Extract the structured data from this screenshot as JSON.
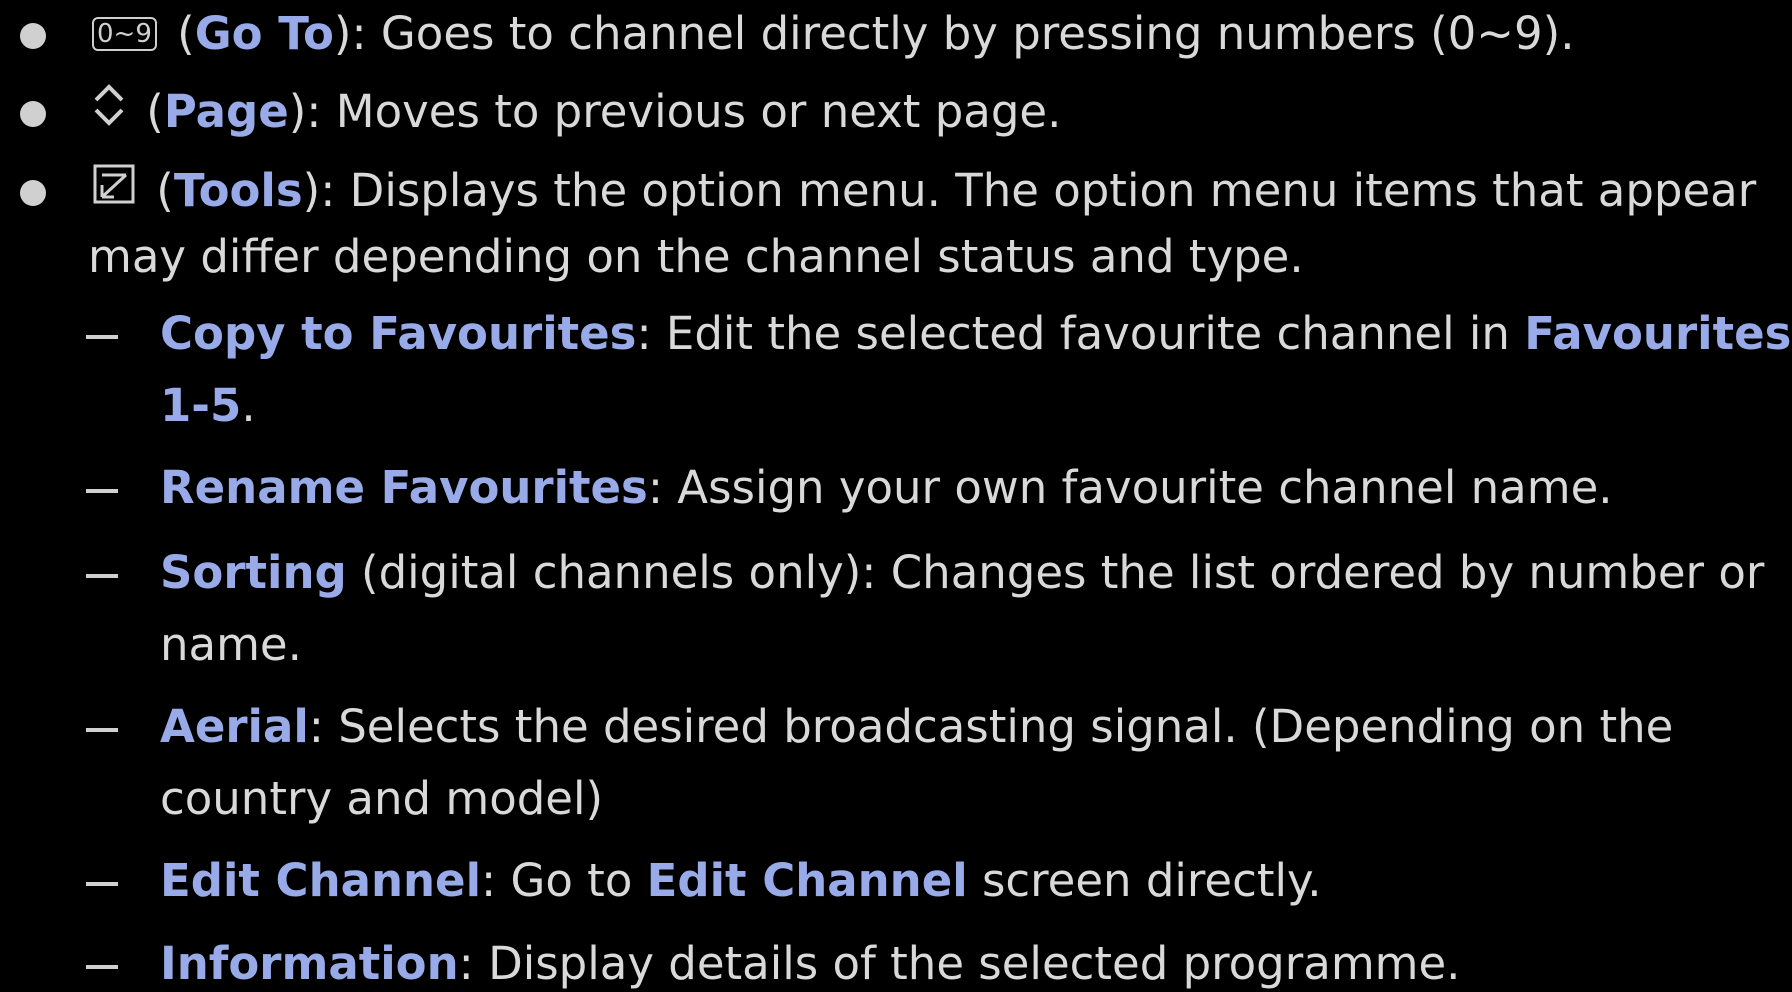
{
  "bullets": [
    {
      "key_label": "0~9",
      "icon": "number-key-icon",
      "open": " (",
      "name": "Go To",
      "desc": "): Goes to channel directly by pressing numbers (0~9)."
    },
    {
      "icon": "page-updown-icon",
      "open": " (",
      "name": "Page",
      "desc": "): Moves to previous or next page."
    },
    {
      "icon": "tools-icon",
      "open": " (",
      "name": "Tools",
      "desc_line1": "): Displays the option menu. The option menu items that appear",
      "desc_line2": "may differ depending on the channel status and type."
    }
  ],
  "sub_items": {
    "copy": {
      "name": "Copy to Favourites",
      "desc": ": Edit the selected favourite channel in ",
      "target_a": "Favourites",
      "target_b": "1-5",
      "end": "."
    },
    "rename": {
      "name": "Rename Favourites",
      "desc": ": Assign your own favourite channel name."
    },
    "sorting": {
      "name": "Sorting",
      "desc_line1": " (digital channels only): Changes the list ordered by number or",
      "desc_line2": "name."
    },
    "aerial": {
      "name": "Aerial",
      "desc_line1": ": Selects the desired broadcasting signal. (Depending on the",
      "desc_line2": "country and model)"
    },
    "edit": {
      "name": "Edit Channel",
      "desc": ": Go to ",
      "target": "Edit Channel",
      "end": " screen directly."
    },
    "info": {
      "name": "Information",
      "desc": ": Display details of the selected programme."
    }
  },
  "colors": {
    "background": "#000000",
    "text": "#d9d9d9",
    "highlight": "#98abe8"
  }
}
